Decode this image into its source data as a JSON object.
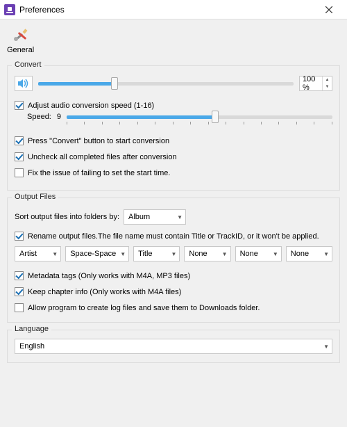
{
  "window": {
    "title": "Preferences",
    "close_icon": "close-icon"
  },
  "category": {
    "label": "General"
  },
  "convert": {
    "legend": "Convert",
    "volume_percent": 30,
    "volume_display": "100 %",
    "adjust_speed_label": "Adjust audio conversion speed (1-16)",
    "adjust_speed_checked": true,
    "speed_label": "Speed:",
    "speed_value": "9",
    "speed_percent": 56,
    "press_convert_label": "Press \"Convert\" button to start conversion",
    "press_convert_checked": true,
    "uncheck_completed_label": "Uncheck all completed files after conversion",
    "uncheck_completed_checked": true,
    "fix_issue_label": "Fix the issue of failing to set the start time.",
    "fix_issue_checked": false
  },
  "output": {
    "legend": "Output Files",
    "sort_label": "Sort output files into folders by:",
    "sort_value": "Album",
    "rename_label": "Rename output files.The file name must contain Title or TrackID, or it won't be applied.",
    "rename_checked": true,
    "cols": [
      "Artist",
      "Space-Space",
      "Title",
      "None",
      "None",
      "None"
    ],
    "metadata_label": "Metadata tags (Only works with M4A, MP3 files)",
    "metadata_checked": true,
    "chapter_label": "Keep chapter info (Only works with M4A files)",
    "chapter_checked": true,
    "logs_label": "Allow program to create log files and save them to Downloads folder.",
    "logs_checked": false
  },
  "language": {
    "legend": "Language",
    "value": "English"
  }
}
